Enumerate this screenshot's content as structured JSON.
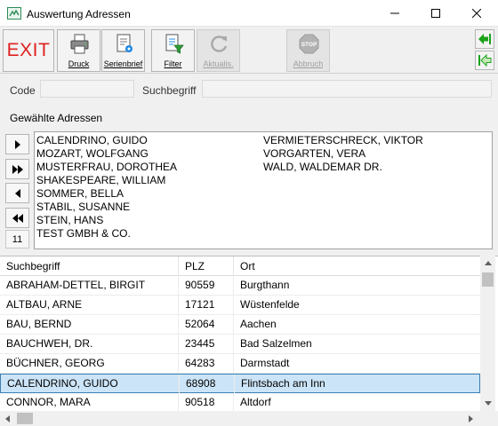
{
  "window": {
    "title": "Auswertung Adressen",
    "icon": "app-icon",
    "controls": [
      "minimize-icon",
      "maximize-icon",
      "close-icon"
    ]
  },
  "toolbar": {
    "exit_label": "EXIT",
    "exit_color": "#e02020",
    "buttons": [
      {
        "label": "Druck",
        "icon": "printer-icon",
        "enabled": true
      },
      {
        "label": "Serienbrief",
        "icon": "letter-icon",
        "enabled": true
      },
      {
        "label": "Filter",
        "icon": "filter-icon",
        "enabled": true
      },
      {
        "label": "Aktualis.",
        "icon": "refresh-icon",
        "enabled": false
      },
      {
        "label": "Abbruch",
        "icon": "stop-icon",
        "enabled": false
      }
    ],
    "nav_icons": [
      "arrow-left-icon",
      "arrow-first-icon"
    ],
    "nav_color": "#19a319"
  },
  "fields": {
    "code_label": "Code",
    "code_value": "",
    "search_label": "Suchbegriff",
    "search_value": ""
  },
  "selection": {
    "label": "Gewählte Adressen",
    "count": "11",
    "buttons": [
      "move-right-icon",
      "move-all-right-icon",
      "move-left-icon",
      "move-all-left-icon"
    ],
    "column1": [
      "CALENDRINO, GUIDO",
      "MOZART, WOLFGANG",
      "MUSTERFRAU, DOROTHEA",
      "SHAKESPEARE, WILLIAM",
      "SOMMER, BELLA",
      "STABIL, SUSANNE",
      "STEIN, HANS",
      "TEST GMBH & CO."
    ],
    "column2": [
      "VERMIETERSCHRECK, VIKTOR",
      "VORGARTEN, VERA",
      "WALD, WALDEMAR DR."
    ]
  },
  "grid": {
    "headers": [
      "Suchbegriff",
      "PLZ",
      "Ort"
    ],
    "selected_index": 5,
    "selected_color": "#cce4f7",
    "rows": [
      [
        "ABRAHAM-DETTEL, BIRGIT",
        "90559",
        "Burgthann"
      ],
      [
        "ALTBAU, ARNE",
        "17121",
        "Wüstenfelde"
      ],
      [
        "BAU, BERND",
        "52064",
        "Aachen"
      ],
      [
        "BAUCHWEH, DR.",
        "23445",
        "Bad Salzelmen"
      ],
      [
        "BÜCHNER, GEORG",
        "64283",
        "Darmstadt"
      ],
      [
        "CALENDRINO, GUIDO",
        "68908",
        "Flintsbach am Inn"
      ],
      [
        "CONNOR, MARA",
        "90518",
        "Altdorf"
      ]
    ]
  }
}
